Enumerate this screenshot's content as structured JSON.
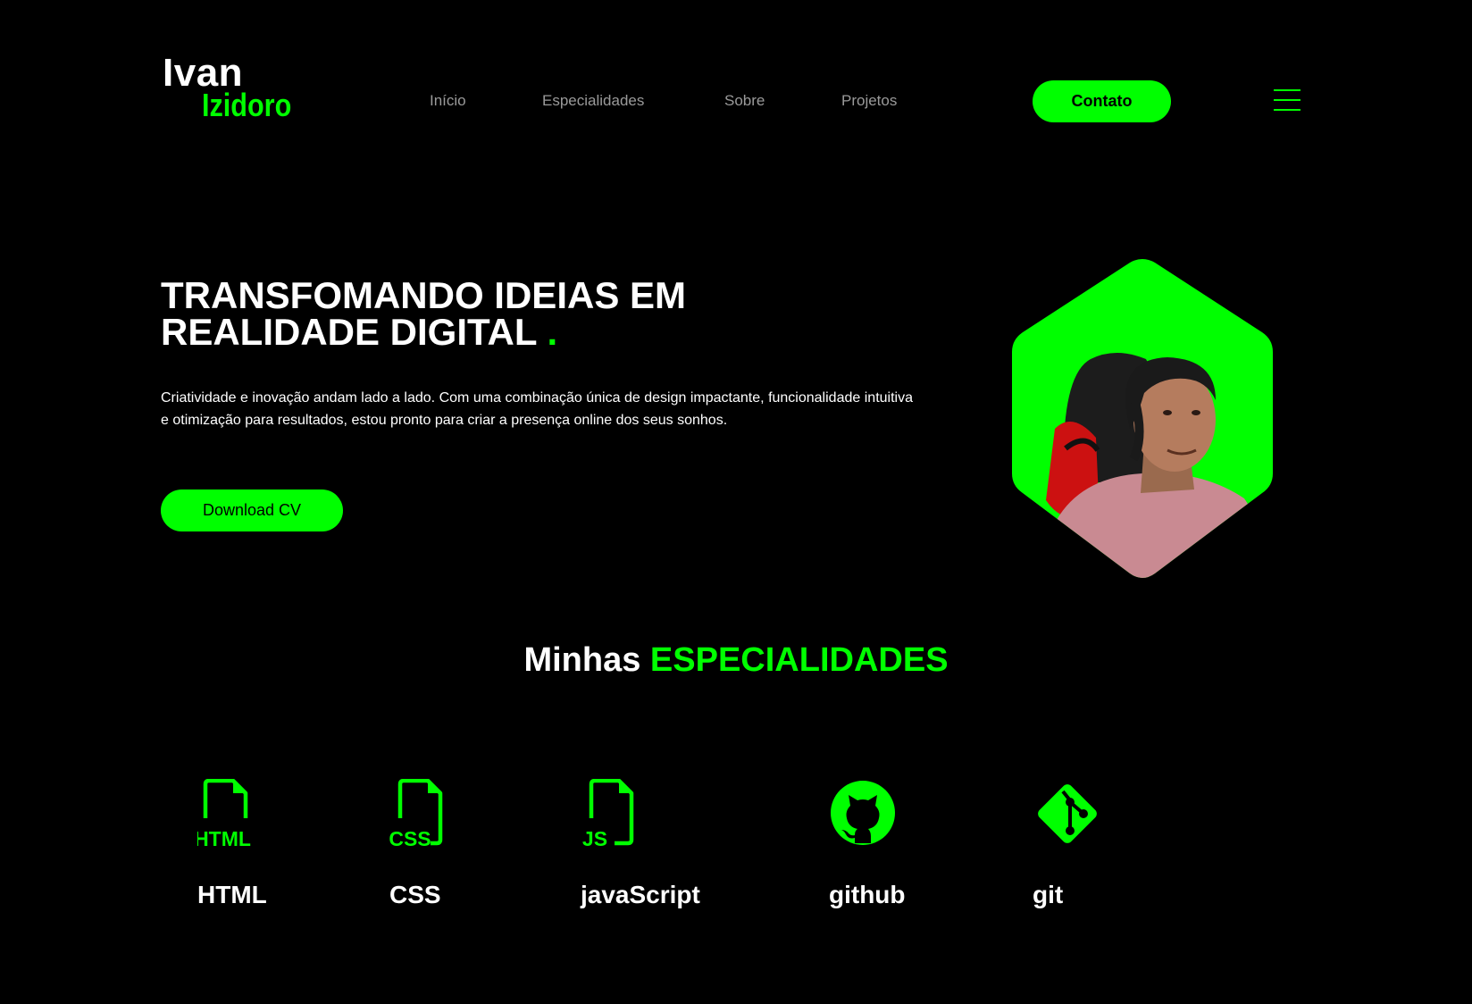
{
  "brand": {
    "first_name": "Ivan",
    "last_name": "Izidoro"
  },
  "nav": {
    "items": [
      {
        "label": "Início"
      },
      {
        "label": "Especialidades"
      },
      {
        "label": "Sobre"
      },
      {
        "label": "Projetos"
      }
    ],
    "contact_label": "Contato",
    "menu_icon": "hamburger-menu-icon"
  },
  "hero": {
    "title": "TRANSFOMANDO IDEIAS EM REALIDADE DIGITAL",
    "title_dot": ".",
    "description": "Criatividade e inovação andam lado a lado. Com uma combinação única de design impactante, funcionalidade intuitiva e otimização para resultados, estou pronto para criar a presença online dos seus sonhos.",
    "cta_label": "Download CV"
  },
  "specialties": {
    "title_prefix": "Minhas",
    "title_accent": "ESPECIALIDADES",
    "items": [
      {
        "label": "HTML",
        "icon": "html-file-icon",
        "icon_text": "HTML"
      },
      {
        "label": "CSS",
        "icon": "css-file-icon",
        "icon_text": "CSS"
      },
      {
        "label": "javaScript",
        "icon": "js-file-icon",
        "icon_text": "JS"
      },
      {
        "label": "github",
        "icon": "github-icon"
      },
      {
        "label": "git",
        "icon": "git-icon"
      }
    ]
  },
  "colors": {
    "accent": "#00ff00",
    "background": "#000000",
    "text": "#ffffff",
    "nav_text": "#9a9a9a"
  }
}
